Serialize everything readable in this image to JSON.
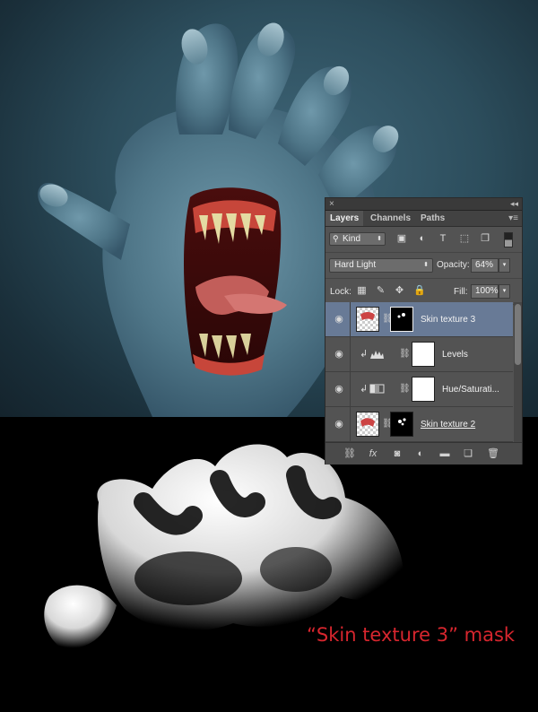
{
  "panel": {
    "close_glyph": "×",
    "collapse_glyph": "◂◂",
    "menu_glyph": "▾≡",
    "tabs": [
      "Layers",
      "Channels",
      "Paths"
    ],
    "active_tab": "Layers",
    "filter_kind": "Kind",
    "blend_mode": "Hard Light",
    "opacity_label": "Opacity:",
    "opacity_value": "64%",
    "lock_label": "Lock:",
    "fill_label": "Fill:",
    "fill_value": "100%",
    "layers": [
      {
        "name": "Skin texture 3",
        "selected": true,
        "type": "image-with-mask"
      },
      {
        "name": "Levels",
        "selected": false,
        "type": "adjustment-levels",
        "clipped": true
      },
      {
        "name": "Hue/Saturati...",
        "selected": false,
        "type": "adjustment-hue",
        "clipped": true
      },
      {
        "name": "Skin texture 2",
        "selected": false,
        "type": "image-with-mask"
      }
    ],
    "filter_icons": [
      "image-filter-icon",
      "adjustment-filter-icon",
      "type-filter-icon",
      "shape-filter-icon",
      "smart-object-filter-icon"
    ],
    "bottom_icons": [
      "link-icon",
      "fx-icon",
      "add-mask-icon",
      "adjustment-layer-icon",
      "folder-icon",
      "new-layer-icon",
      "trash-icon"
    ],
    "selected_color": "#687a96"
  },
  "caption": "“Skin texture 3” mask",
  "caption_color": "#d7262e"
}
